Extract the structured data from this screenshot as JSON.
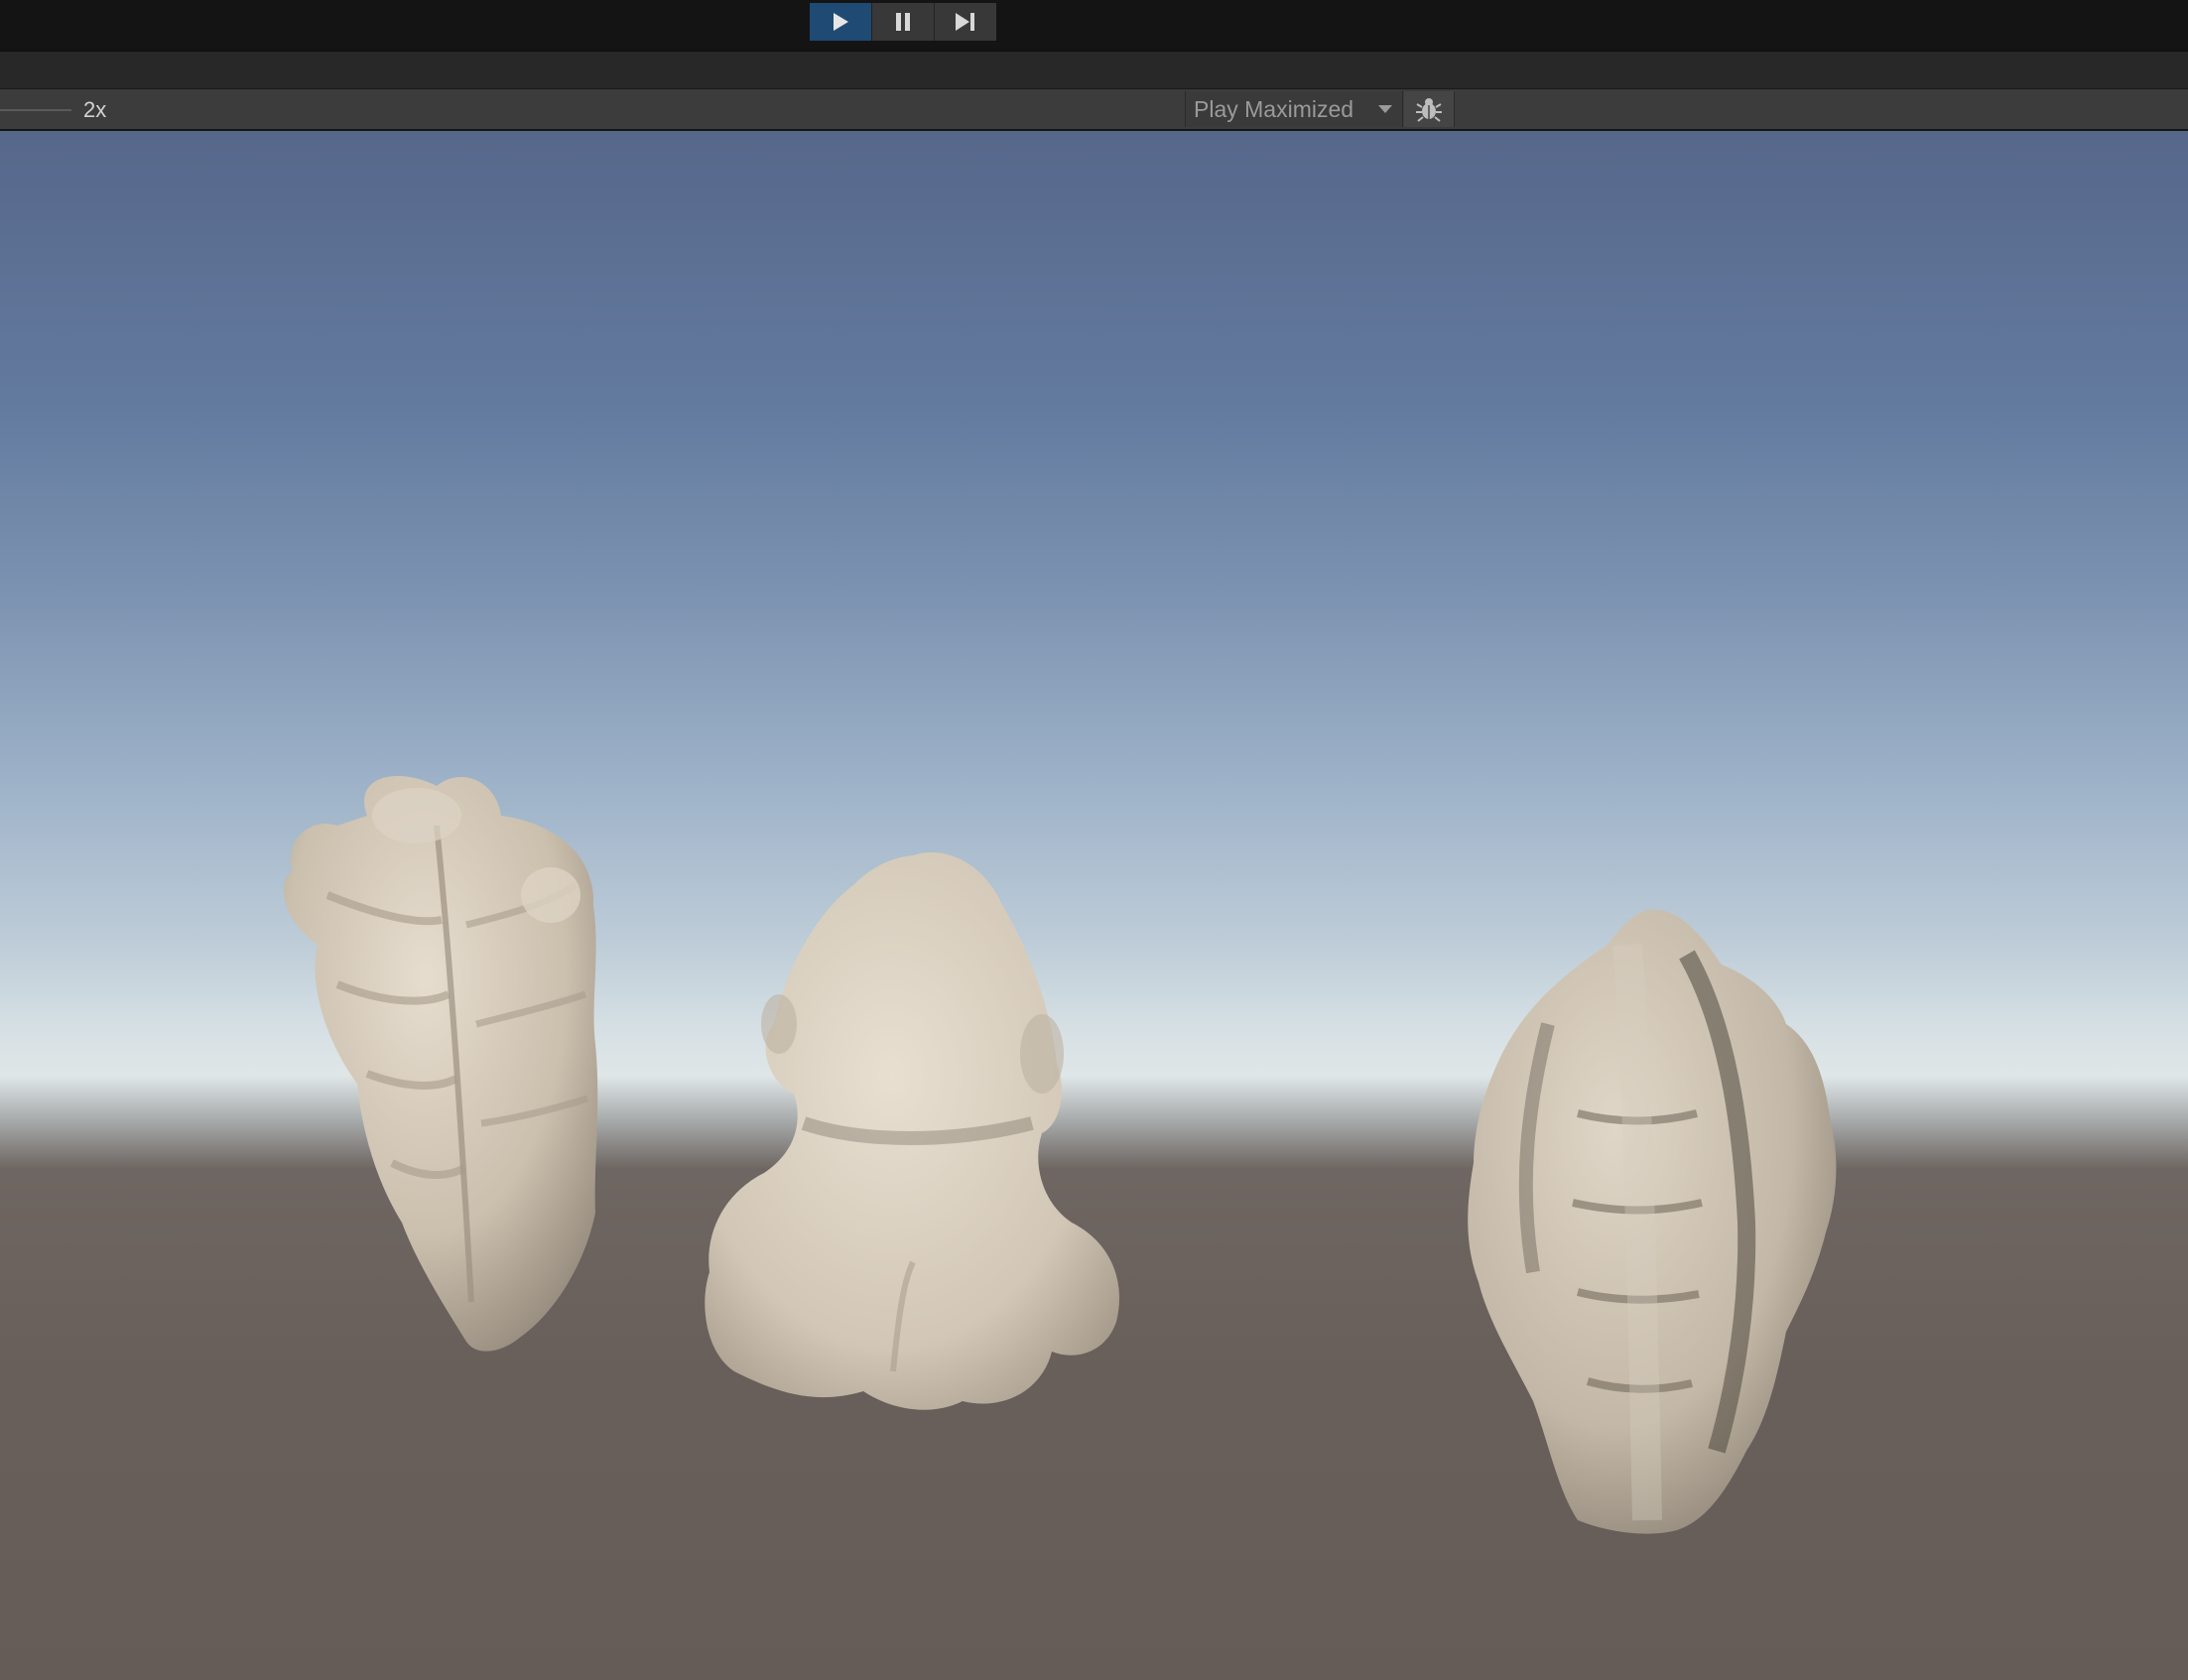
{
  "toolbar": {
    "play_icon": "play-icon",
    "pause_icon": "pause-icon",
    "step_icon": "step-icon",
    "play_active_color": "#1f4a73"
  },
  "game_view": {
    "scale_label": "2x",
    "play_mode_label": "Play Maximized",
    "play_mode_icon": "chevron-down-icon",
    "bug_icon": "bug-icon"
  },
  "scene": {
    "sky_color_top": "#56678a",
    "horizon_color": "#dfe6e8",
    "ground_color": "#675d59",
    "object_color": "#cfc4b4"
  }
}
